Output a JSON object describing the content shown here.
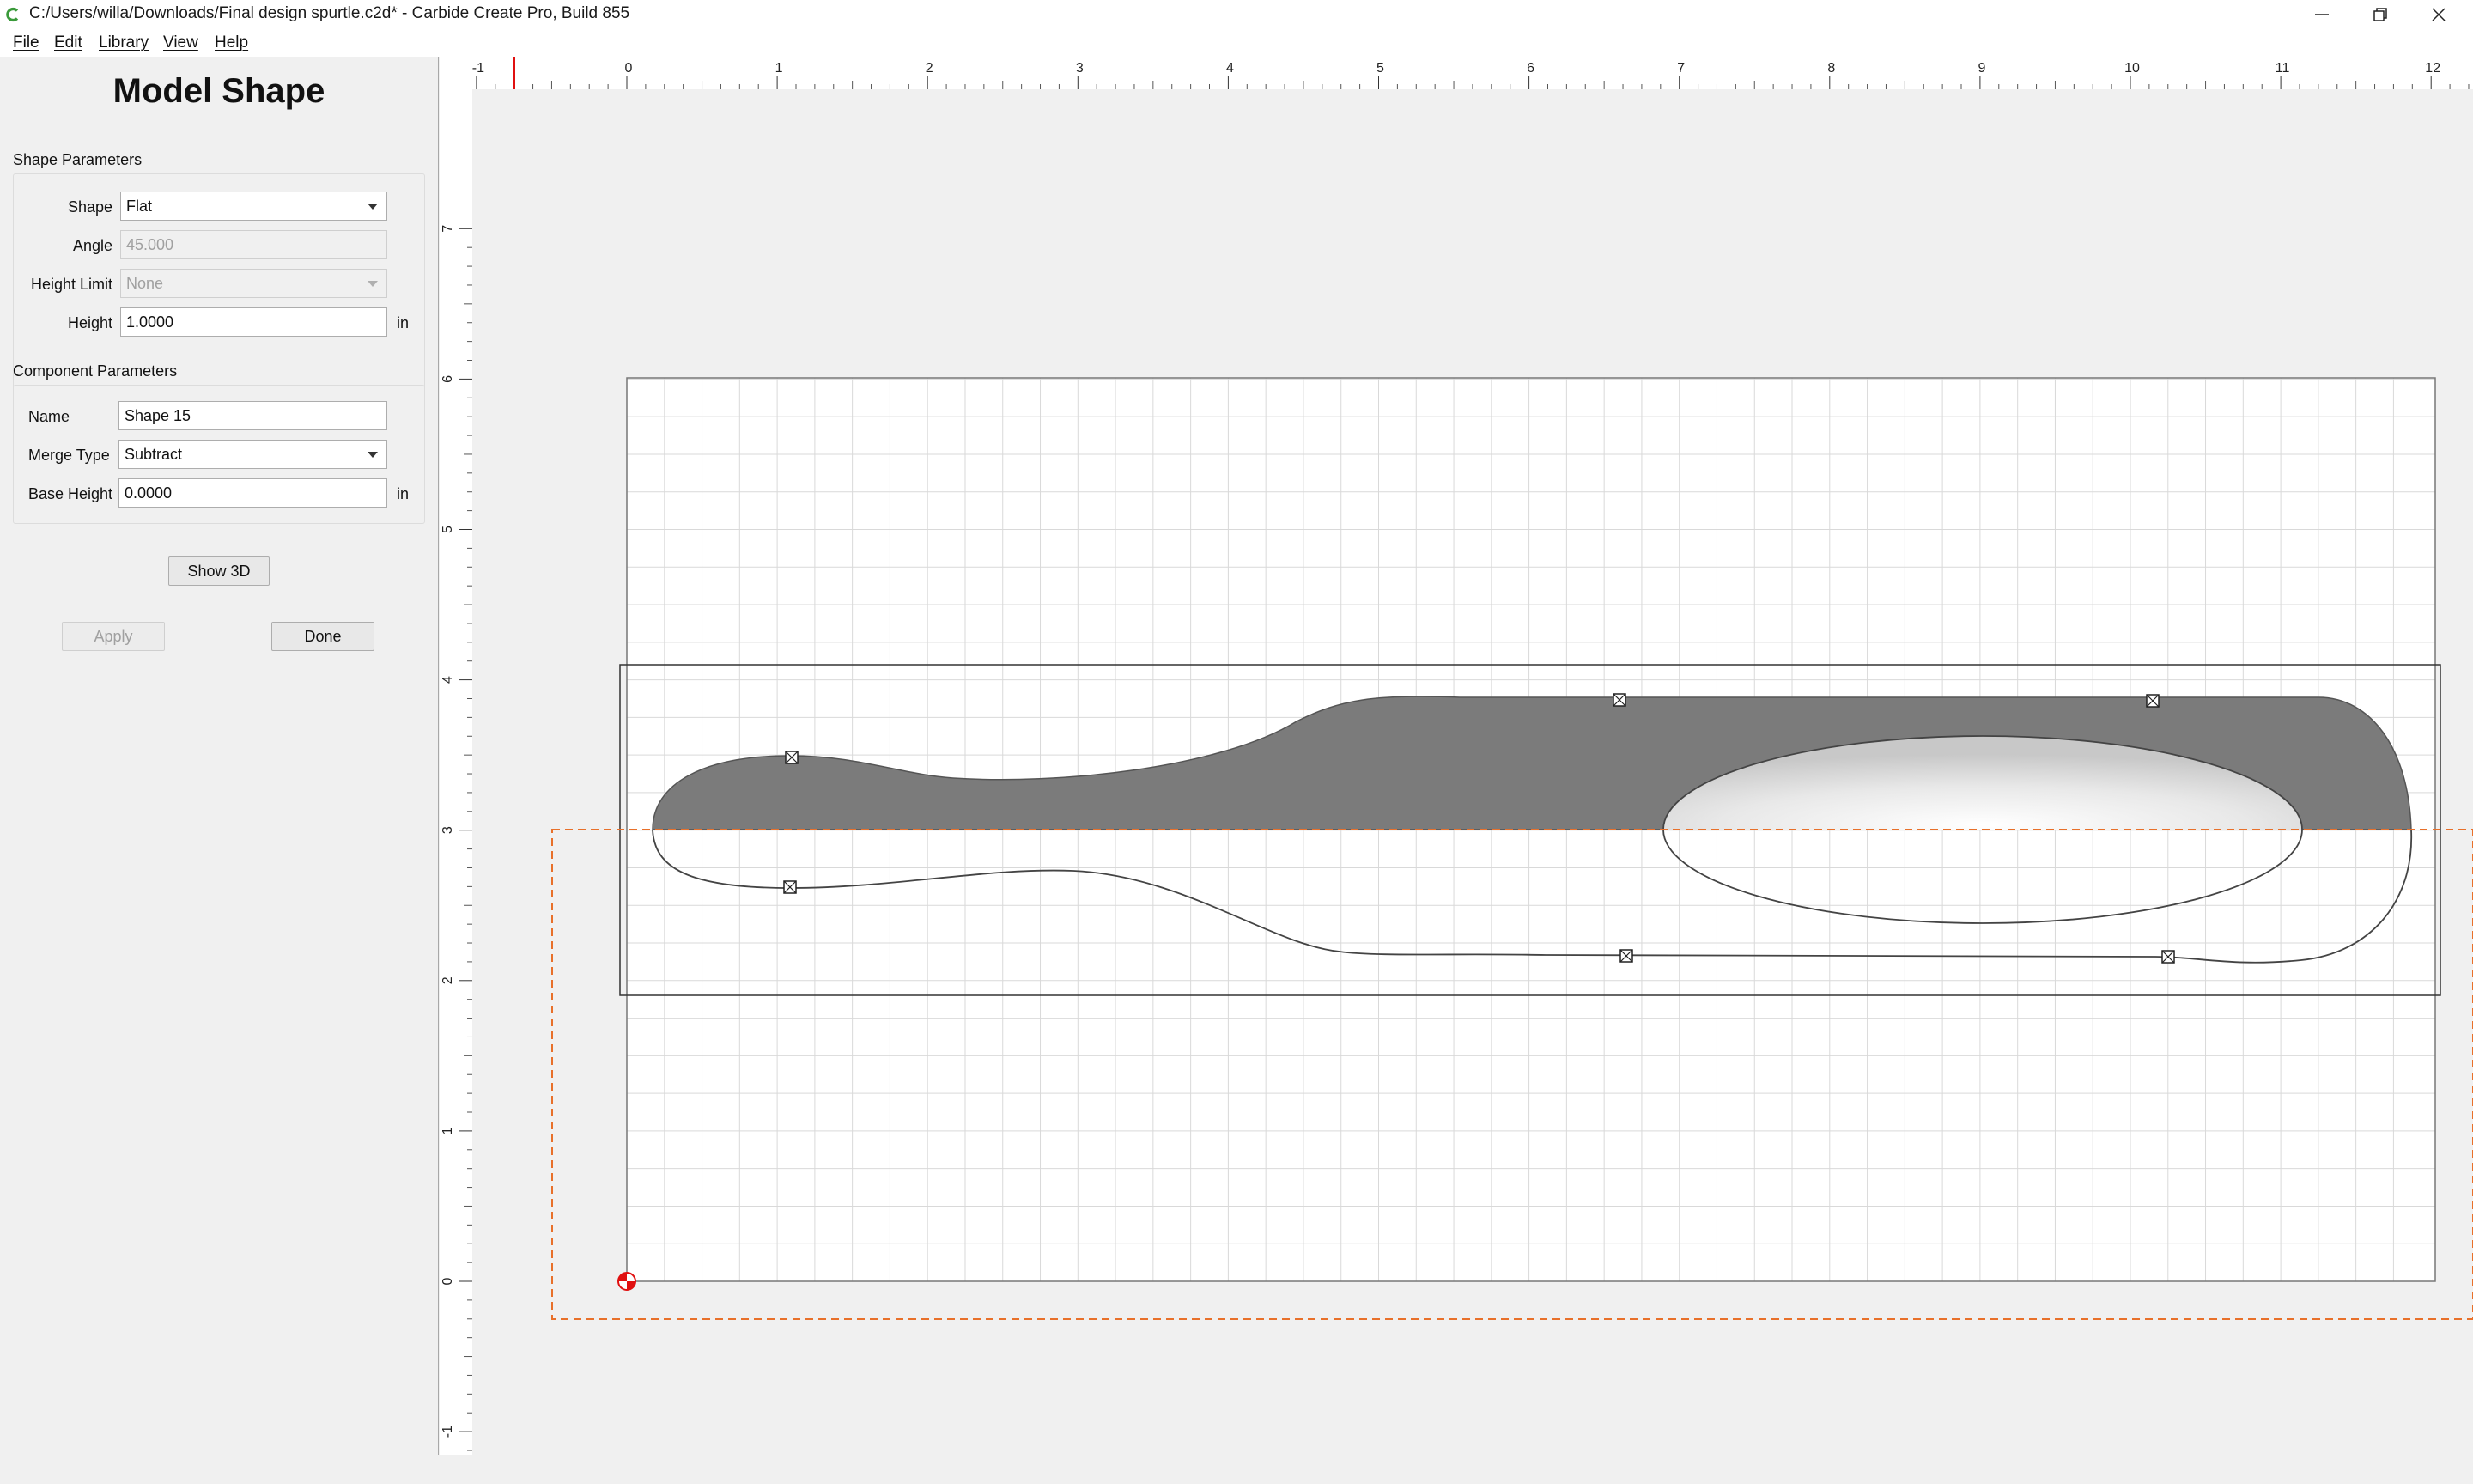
{
  "window": {
    "title": "C:/Users/willa/Downloads/Final design spurtle.c2d* - Carbide Create Pro, Build 855"
  },
  "menu": {
    "items": [
      "File",
      "Edit",
      "Library",
      "View",
      "Help"
    ]
  },
  "panel": {
    "title": "Model Shape",
    "shape_params": {
      "label": "Shape Parameters",
      "shape_label": "Shape",
      "shape_value": "Flat",
      "angle_label": "Angle",
      "angle_value": "45.000",
      "height_limit_label": "Height Limit",
      "height_limit_value": "None",
      "height_label": "Height",
      "height_value": "1.0000",
      "height_unit": "in"
    },
    "component_params": {
      "label": "Component Parameters",
      "name_label": "Name",
      "name_value": "Shape 15",
      "merge_type_label": "Merge Type",
      "merge_type_value": "Subtract",
      "base_height_label": "Base Height",
      "base_height_value": "0.0000",
      "base_height_unit": "in"
    },
    "buttons": {
      "show3d": "Show 3D",
      "apply": "Apply",
      "done": "Done"
    }
  },
  "rulers": {
    "horizontal_ticks": [
      "-1",
      "0",
      "1",
      "2",
      "3",
      "4",
      "5",
      "6",
      "7",
      "8",
      "9",
      "10",
      "11",
      "12"
    ],
    "vertical_ticks": [
      "7",
      "6",
      "5",
      "4",
      "3",
      "2",
      "1",
      "0",
      "-1"
    ]
  },
  "colors": {
    "shape_fill": "#7b7b7b",
    "selection_dash": "#e8702a",
    "origin_marker": "#e01010",
    "grid_line": "#d6d6d6"
  }
}
